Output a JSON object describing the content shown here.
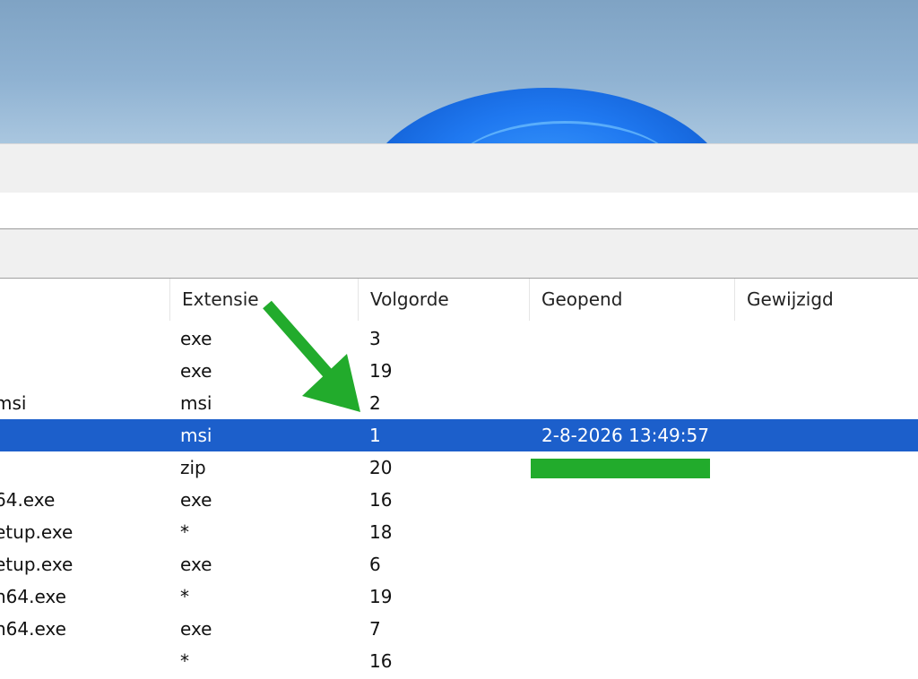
{
  "columns": [
    "Extensie",
    "Volgorde",
    "Geopend",
    "Gewijzigd"
  ],
  "rows": [
    {
      "name": "",
      "ext": "exe",
      "order": "3",
      "opened": ""
    },
    {
      "name": "",
      "ext": "exe",
      "order": "19",
      "opened": ""
    },
    {
      "name": "msi",
      "ext": "msi",
      "order": "2",
      "opened": ""
    },
    {
      "name": "",
      "ext": "msi",
      "order": "1",
      "opened": "2-8-2026 13:49:57",
      "selected": true
    },
    {
      "name": "",
      "ext": "zip",
      "order": "20",
      "opened": ""
    },
    {
      "name": "64.exe",
      "ext": "exe",
      "order": "16",
      "opened": ""
    },
    {
      "name": "etup.exe",
      "ext": "*",
      "order": "18",
      "opened": ""
    },
    {
      "name": "etup.exe",
      "ext": "exe",
      "order": "6",
      "opened": ""
    },
    {
      "name": "n64.exe",
      "ext": "*",
      "order": "19",
      "opened": ""
    },
    {
      "name": "n64.exe",
      "ext": "exe",
      "order": "7",
      "opened": ""
    },
    {
      "name": "",
      "ext": "*",
      "order": "16",
      "opened": ""
    }
  ],
  "colors": {
    "selection": "#1c5fcb",
    "arrow": "#22ab2c",
    "redaction_bar": "#22ab2c"
  }
}
